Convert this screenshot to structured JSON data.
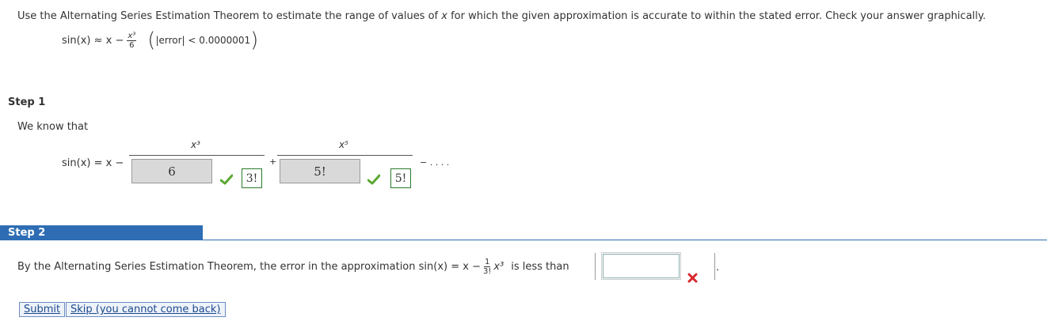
{
  "problem": {
    "instruction_pre": "Use the Alternating Series Estimation Theorem to estimate the range of values of ",
    "instruction_var": "x",
    "instruction_post": " for which the given approximation is accurate to within the stated error. Check your answer graphically.",
    "approx_lhs": "sin(x) ≈ x −",
    "approx_num": "x³",
    "approx_den": "6",
    "error_text": "|error| < 0.0000001"
  },
  "step1": {
    "label": "Step 1",
    "intro": "We know that",
    "series_lhs": "sin(x) = x −",
    "term1_num": "x³",
    "term1_answer": "6",
    "term1_correct": "3!",
    "plus": "+",
    "term2_num": "x⁵",
    "term2_answer": "5!",
    "term2_correct": "5!",
    "tail": "− . . . ."
  },
  "step2": {
    "label": "Step 2",
    "text_pre": "By the Alternating Series Estimation Theorem, the error in the approximation  sin(x) = x −",
    "frac_num": "1",
    "frac_den": "3!",
    "frac_var": "x³",
    "text_post": "is less than",
    "answer_value": "",
    "period": "."
  },
  "buttons": {
    "submit": "Submit",
    "skip": "Skip (you cannot come back)"
  },
  "colors": {
    "accent": "#2e6db4",
    "correct": "#5aa832",
    "incorrect": "#d9262b"
  }
}
